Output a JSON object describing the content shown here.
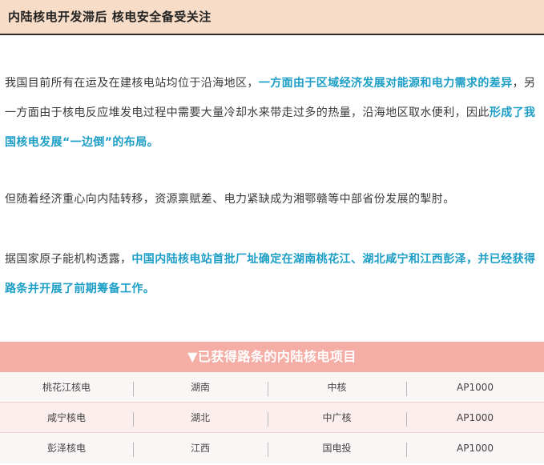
{
  "header": {
    "title": "内陆核电开发滞后 核电安全备受关注"
  },
  "paragraphs": {
    "p1": {
      "part1": "我国目前所有在运及在建核电站均位于沿海地区，",
      "highlight1": "一方面由于区域经济发展对能源和电力需求的差异",
      "part2": "，另一方面由于核电反应堆发电过程中需要大量冷却水来带走过多的热量，沿海地区取水便利，因此",
      "highlight2": "形成了我国核电发展“一边倒”的布局。"
    },
    "p2": {
      "text": "但随着经济重心向内陆转移，资源禀赋差、电力紧缺成为湘鄂赣等中部省份发展的掣肘。"
    },
    "p3": {
      "part1": "据国家原子能机构透露，",
      "highlight1": "中国内陆核电站首批厂址确定在湖南桃花江、湖北咸宁和江西彭泽，并已经获得路条并开展了前期筹备工作。"
    }
  },
  "table": {
    "heading": "▼已获得路条的内陆核电项目",
    "rows": [
      [
        "桃花江核电",
        "湖南",
        "中核",
        "AP1000"
      ],
      [
        "咸宁核电",
        "湖北",
        "中广核",
        "AP1000"
      ],
      [
        "彭泽核电",
        "江西",
        "国电投",
        "AP1000"
      ]
    ]
  },
  "colors": {
    "header_bg": "#f7dcc7",
    "highlight": "#1d9ec7",
    "table_head_bg": "#f4aea6"
  }
}
